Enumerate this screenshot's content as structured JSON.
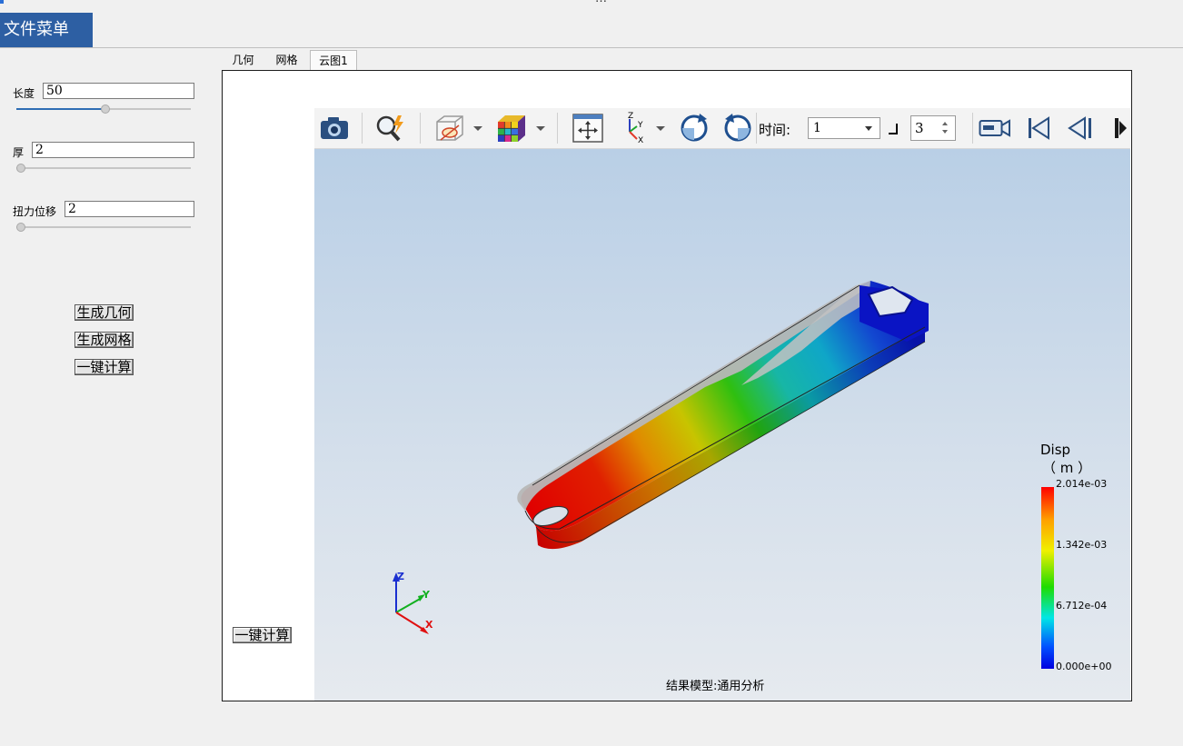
{
  "window": {
    "title_fragment": "…"
  },
  "menu": {
    "file_menu": "文件菜单"
  },
  "params": [
    {
      "label": "长度",
      "value": "50",
      "slider_fraction": 0.51
    },
    {
      "label": "厚",
      "value": "2",
      "slider_fraction": 0.0
    },
    {
      "label": "扭力位移",
      "value": "2",
      "slider_fraction": 0.0
    }
  ],
  "actions": {
    "gen_geometry": "生成几何",
    "gen_mesh": "生成网格",
    "one_click_calc": "一键计算"
  },
  "bottom_calc": "一键计算",
  "tabs": [
    {
      "label": "几何",
      "active": false
    },
    {
      "label": "网格",
      "active": false
    },
    {
      "label": "云图1",
      "active": true
    }
  ],
  "toolbar": {
    "icons": [
      "camera-icon",
      "zoom-lightning-icon",
      "display-style-icon",
      "color-cube-icon",
      "fit-view-icon",
      "axis-view-icon",
      "rotate-cw-icon",
      "rotate-ccw-icon",
      "video-record-icon",
      "first-frame-icon",
      "prev-frame-icon",
      "play-icon"
    ],
    "time_label": "时间:",
    "time_value": "1",
    "step_value": "3"
  },
  "legend": {
    "title": "Disp",
    "unit": "（ m ）",
    "values": [
      "2.014e-03",
      "1.342e-03",
      "6.712e-04",
      "0.000e+00"
    ]
  },
  "model_label": "结果模型:通用分析",
  "triad": {
    "x": "X",
    "y": "Y",
    "z": "Z"
  },
  "colors": {
    "menu_bg": "#2d5fa3",
    "slider_fill": "#2e6db4"
  }
}
